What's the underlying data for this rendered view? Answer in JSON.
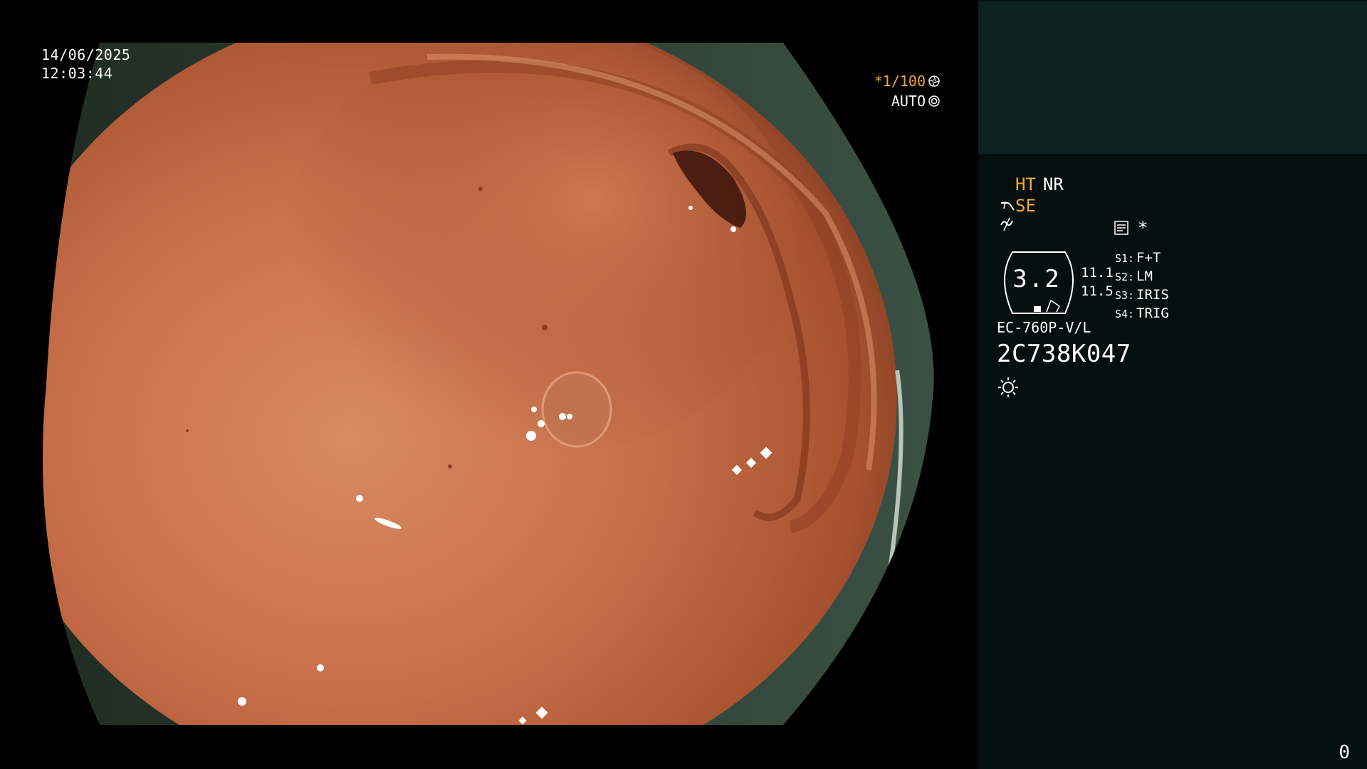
{
  "image": {
    "date": "14/06/2025",
    "time": "12:03:44",
    "shutter_value": "*1/100",
    "iris_mode": "AUTO"
  },
  "panel": {
    "mode_ht": "HT",
    "mode_nr": "NR",
    "mode_se": "SE",
    "memo_star": "*",
    "gauge_value": "3.2",
    "gauge_side_top": "11.1",
    "gauge_side_bottom": "11.5",
    "settings": [
      {
        "key": "S1:",
        "value": "F+T"
      },
      {
        "key": "S2:",
        "value": "LM"
      },
      {
        "key": "S3:",
        "value": "IRIS"
      },
      {
        "key": "S4:",
        "value": "TRIG"
      }
    ],
    "scope_model": "EC-760P-V/L",
    "scope_serial": "2C738K047",
    "counter": "0"
  },
  "colors": {
    "accent_orange": "#f0a830",
    "panel_bg": "#050f0e",
    "panel_top_bg": "#0e2224",
    "tissue": "#c8704a"
  },
  "icons": [
    "aperture-icon",
    "iris-icon",
    "scope-bend-icon",
    "enhance-symbol-icon",
    "memo-card-icon",
    "light-source-icon"
  ]
}
